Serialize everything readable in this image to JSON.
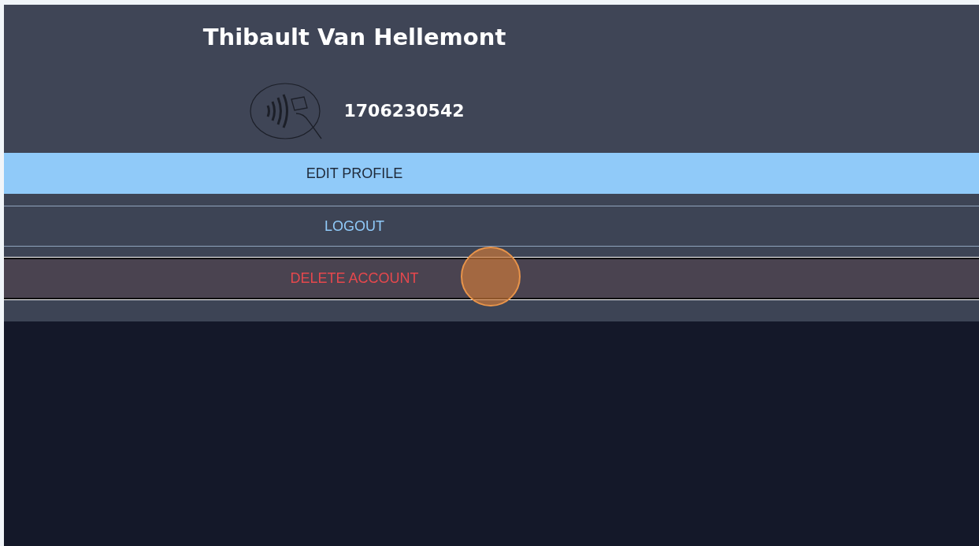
{
  "profile": {
    "name": "Thibault Van Hellemont",
    "card_number": "1706230542"
  },
  "actions": [
    {
      "kind": "primary",
      "label": "EDIT PROFILE"
    },
    {
      "kind": "outline",
      "label": "LOGOUT"
    },
    {
      "kind": "danger",
      "label": "DELETE ACCOUNT"
    }
  ]
}
